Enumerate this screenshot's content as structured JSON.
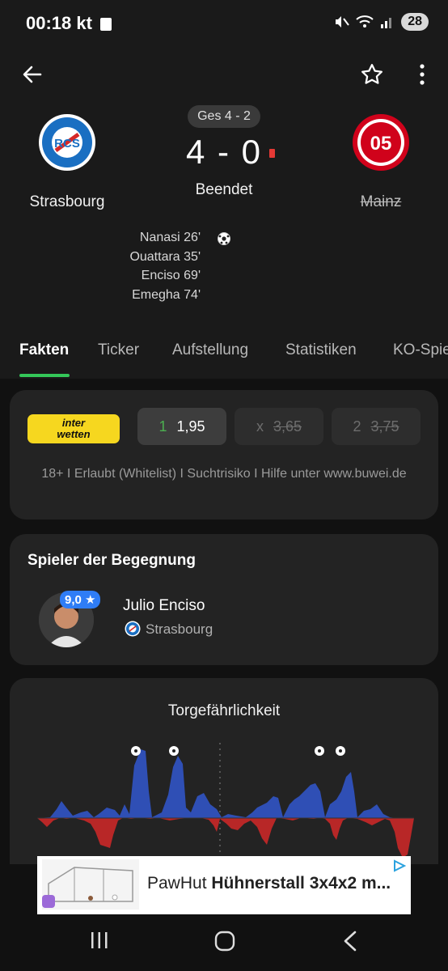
{
  "status_bar": {
    "time": "00:18",
    "carrier": "kt",
    "battery": "28"
  },
  "top_bar": {
    "back_icon": "arrow-left-icon",
    "favorite_icon": "star-outline-icon",
    "menu_icon": "more-vertical-icon"
  },
  "match": {
    "aggregate": "Ges 4 - 2",
    "score": "4 - 0",
    "status": "Beendet",
    "home_team": "Strasbourg",
    "away_team": "Mainz",
    "home_scorers": [
      "Nanasi 26'",
      "Ouattara 35'",
      "Enciso 69'",
      "Emegha 74'"
    ]
  },
  "tabs": [
    "Fakten",
    "Ticker",
    "Aufstellung",
    "Statistiken",
    "KO-Spie"
  ],
  "betting": {
    "bookmaker_line1": "inter",
    "bookmaker_line2": "wetten",
    "odds": [
      {
        "label": "1",
        "value": "1,95"
      },
      {
        "label": "x",
        "value": "3,65"
      },
      {
        "label": "2",
        "value": "3,75"
      }
    ],
    "disclaimer": "18+ I Erlaubt (Whitelist) I Suchtrisiko I Hilfe unter www.buwei.de"
  },
  "player_of_match": {
    "title": "Spieler der Begegnung",
    "rating": "9,0",
    "name": "Julio Enciso",
    "club": "Strasbourg"
  },
  "danger_chart": {
    "title": "Torgefährlichkeit"
  },
  "ad": {
    "brand": "PawHut",
    "text": "Hühnerstall 3x4x2 m..."
  },
  "colors": {
    "accent_green": "#34c759",
    "home_bar": "#2f4fb5",
    "away_bar": "#b82727",
    "bookmaker_yellow": "#f6d71f",
    "rating_blue": "#2f7df6"
  }
}
